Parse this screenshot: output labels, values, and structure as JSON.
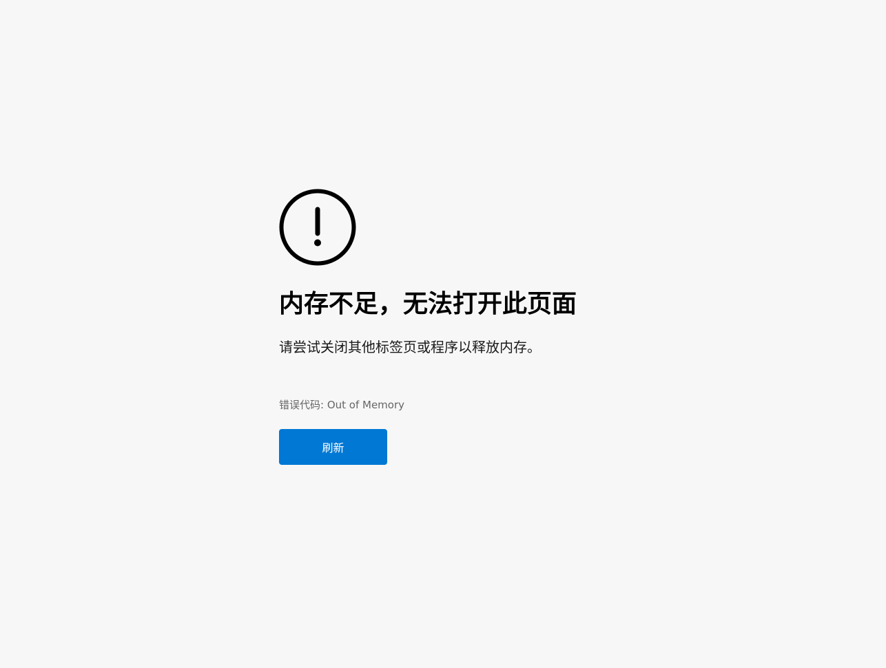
{
  "error": {
    "icon": "alert-circle-icon",
    "title": "内存不足，无法打开此页面",
    "message": "请尝试关闭其他标签页或程序以释放内存。",
    "code_label": "错误代码: Out of Memory",
    "refresh_label": "刷新"
  },
  "colors": {
    "background": "#f7f7f7",
    "accent": "#0078d4",
    "icon": "#000000",
    "muted_text": "#666666"
  }
}
